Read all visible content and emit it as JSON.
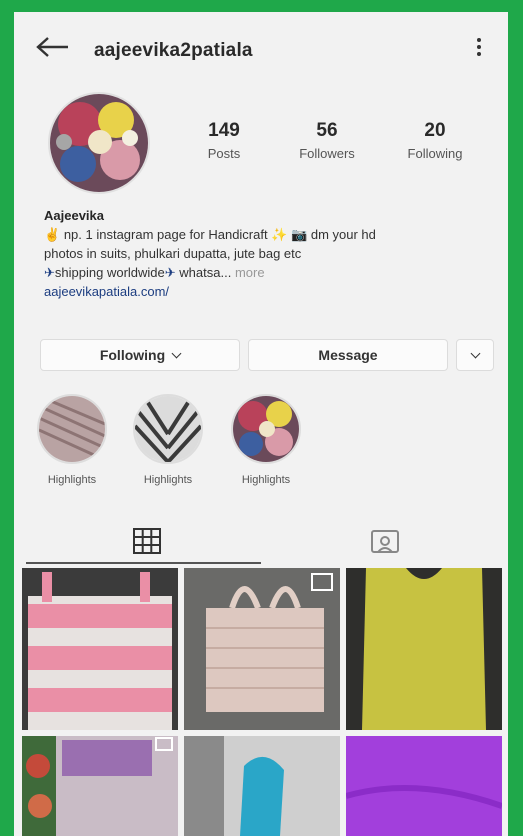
{
  "header": {
    "username": "aajeevika2patiala",
    "icons": {
      "back": "back-arrow-icon",
      "more": "more-vertical-icon"
    }
  },
  "profile": {
    "stats": [
      {
        "value": "149",
        "label": "Posts"
      },
      {
        "value": "56",
        "label": "Followers"
      },
      {
        "value": "20",
        "label": "Following"
      }
    ],
    "name": "Aajeevika",
    "bio_line1": "np. 1 instagram page for Handicraft",
    "bio_line1b": "dm your hd",
    "bio_line2": "photos in suits, phulkari dupatta, jute bag etc",
    "bio_line3": "shipping worldwide",
    "bio_line3b": "whatsa...",
    "more_label": "more",
    "website": "aajeevikapatiala.com/"
  },
  "actions": {
    "following_label": "Following",
    "message_label": "Message"
  },
  "highlights": [
    {
      "label": "Highlights"
    },
    {
      "label": "Highlights"
    },
    {
      "label": "Highlights"
    }
  ],
  "tabs": [
    {
      "name": "grid-icon",
      "active": true
    },
    {
      "name": "tagged-icon",
      "active": false
    }
  ],
  "colors": {
    "frame": "#1fa84a",
    "link": "#1c3d80",
    "text": "#262626"
  }
}
